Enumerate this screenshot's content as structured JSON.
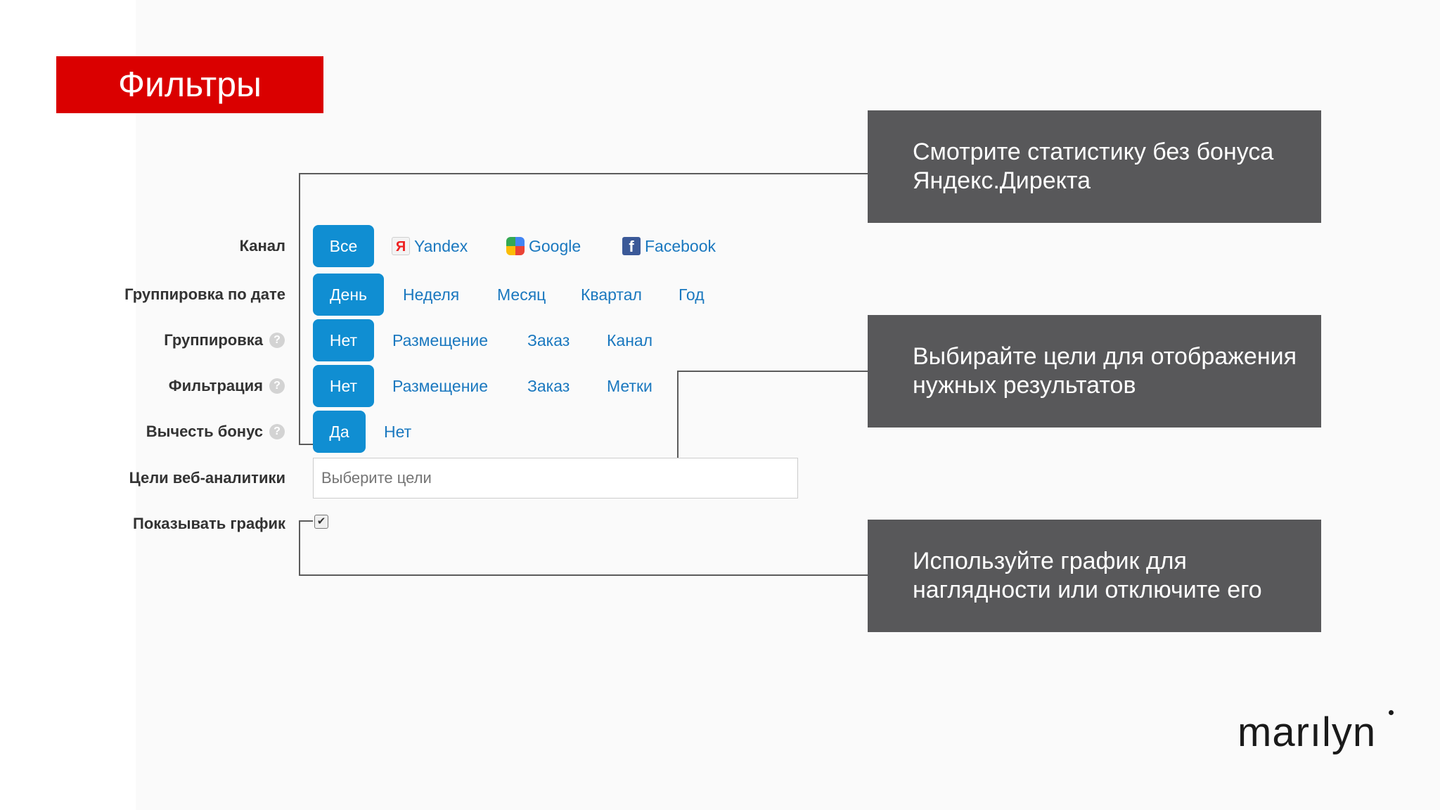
{
  "title": "Фильтры",
  "callouts": {
    "bonus": "Смотрите статистику без бонуса\nЯндекс.Директа",
    "goals": "Выбирайте цели для отображения\nнужных результатов",
    "chart": "Используйте график для\nнаглядности или отключите его"
  },
  "filters": {
    "channel": {
      "label": "Канал",
      "options": [
        "Все",
        "Yandex",
        "Google",
        "Facebook"
      ],
      "selected": "Все"
    },
    "date_grouping": {
      "label": "Группировка по дате",
      "options": [
        "День",
        "Неделя",
        "Месяц",
        "Квартал",
        "Год"
      ],
      "selected": "День"
    },
    "grouping": {
      "label": "Группировка",
      "options": [
        "Нет",
        "Размещение",
        "Заказ",
        "Канал"
      ],
      "selected": "Нет"
    },
    "filtering": {
      "label": "Фильтрация",
      "options": [
        "Нет",
        "Размещение",
        "Заказ",
        "Метки"
      ],
      "selected": "Нет"
    },
    "subtract_bonus": {
      "label": "Вычесть бонус",
      "options": [
        "Да",
        "Нет"
      ],
      "selected": "Да"
    },
    "web_goals": {
      "label": "Цели веб-аналитики",
      "placeholder": "Выберите цели"
    },
    "show_chart": {
      "label": "Показывать график",
      "checked": true
    }
  },
  "help_icon_glyph": "?",
  "checkbox_glyph": "✔",
  "logo": "marılyn",
  "colors": {
    "title_bg": "#da0000",
    "callout_bg": "#58585a",
    "active_button": "#108ed2",
    "link": "#1a78bf"
  }
}
